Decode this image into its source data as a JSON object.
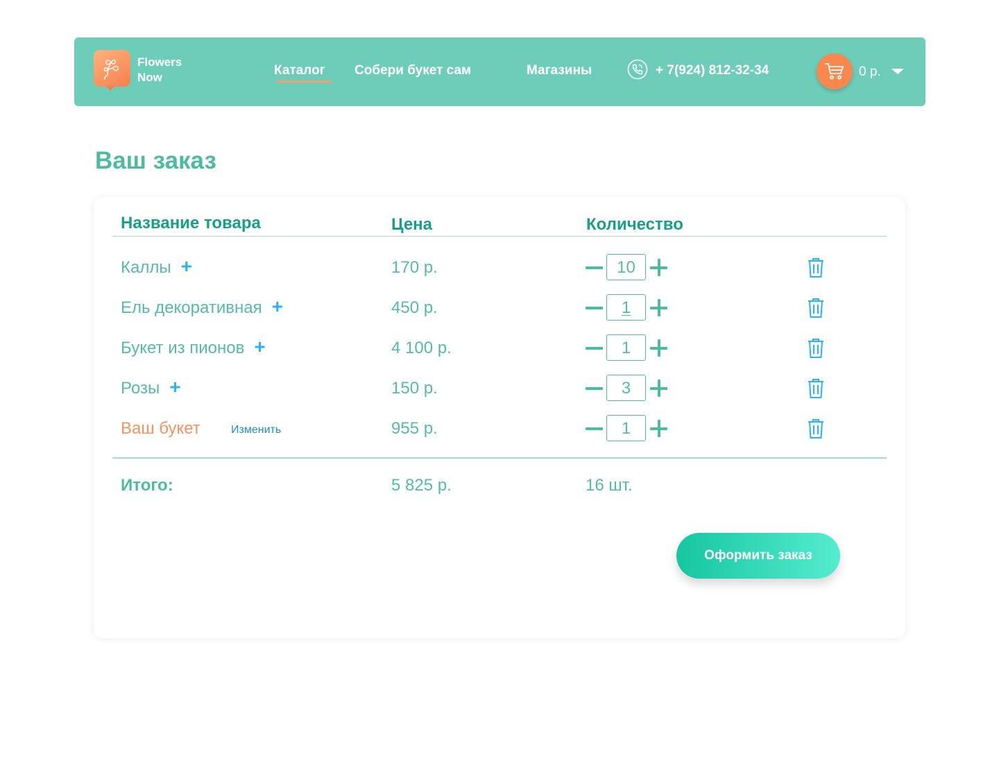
{
  "header": {
    "brand_line1": "Flowers",
    "brand_line2": "Now",
    "nav": [
      {
        "label": "Каталог",
        "active": true
      },
      {
        "label": "Собери букет сам"
      },
      {
        "label": "Магазины"
      }
    ],
    "phone": "+ 7(924) 812-32-34",
    "cart_total": "0 р.",
    "icons": {
      "logo": "flower-logo-icon",
      "phone": "phone-icon",
      "cart": "cart-icon",
      "caret": "chevron-down-icon"
    }
  },
  "page_title": "Ваш заказ",
  "table": {
    "headers": {
      "name": "Название товара",
      "price": "Цена",
      "quantity": "Количество"
    },
    "rows": [
      {
        "name": "Каллы",
        "price": "170 р.",
        "qty": "10"
      },
      {
        "name": "Ель декоративная",
        "price": "450 р.",
        "qty": "1"
      },
      {
        "name": "Букет из пионов",
        "price": "4 100 р.",
        "qty": "1"
      },
      {
        "name": "Розы",
        "price": "150 р.",
        "qty": "3"
      },
      {
        "name": "Ваш букет",
        "edit_label": "Изменить",
        "price": "955 р.",
        "qty": "1"
      }
    ],
    "total": {
      "label": "Итого:",
      "price": "5 825 р.",
      "qty": "16 шт."
    }
  },
  "order_button": "Оформить заказ",
  "colors": {
    "header_bg": "#6dcdb8",
    "accent_green": "#4cbb9f",
    "accent_orange": "#f9884f",
    "plus_blue": "#2ab3f0",
    "button_gradient": [
      "#16c6a1",
      "#55ecd0"
    ]
  }
}
